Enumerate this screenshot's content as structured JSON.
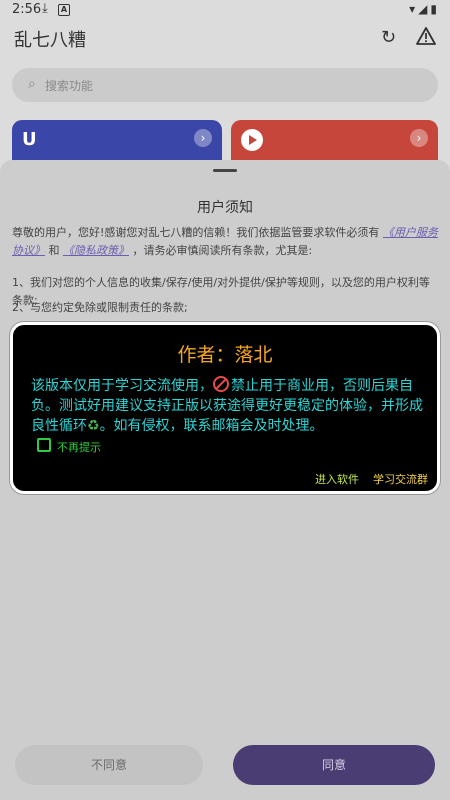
{
  "status_bar": {
    "time": "2:56",
    "download_glyph": "⤓",
    "a_glyph": "A",
    "right_glyphs": "▾◢▮"
  },
  "app_bar": {
    "title": "乱七八糟",
    "refresh_glyph": "↻"
  },
  "search": {
    "placeholder": "搜索功能",
    "icon_glyph": "⌕"
  },
  "cards": [
    {
      "lead_glyph": "U",
      "arrow_glyph": "›",
      "color": "#3b47a8"
    },
    {
      "arrow_glyph": "›",
      "color": "#c6463c"
    }
  ],
  "sheet": {
    "title": "用户须知",
    "p1_a": "尊敬的用户，您好!感谢您对乱七八糟的信赖！我们依据监管要求软件必须有",
    "p1_link1": "《用户服务协议》",
    "p1_and": "和",
    "p1_link2": "《隐私政策》",
    "p1_b": "，请务必审慎阅读所有条款，尤其是:",
    "p2": "1、我们对您的个人信息的收集/保存/使用/对外提供/保护等规则，以及您的用户权利等条款;",
    "p3": "2、与您约定免除或限制责任的条款;",
    "disagree": "不同意",
    "agree": "同意"
  },
  "dialog": {
    "title": "作者：落北",
    "msg_a": "该版本仅用于学习交流使用，",
    "msg_b": "禁止用于商业用，否则后果自负。测试好用建议支持正版以获途得更好更稳定的体验，并形成良性循环",
    "recycle": "♻",
    "msg_c": "。如有侵权，联系邮箱会及时处理。",
    "checkbox_label": "不再提示",
    "enter": "进入软件",
    "group": "学习交流群"
  },
  "colors": {
    "accent_purple": "#4a3d73",
    "dialog_title": "#f5a623",
    "dialog_text": "#2bd5d5",
    "checkbox_green": "#2ecc40"
  }
}
